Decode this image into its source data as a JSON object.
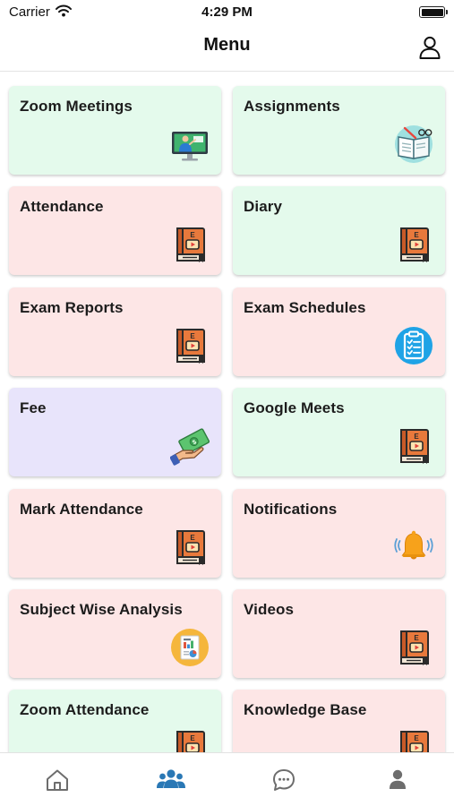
{
  "status_bar": {
    "carrier": "Carrier",
    "time": "4:29 PM"
  },
  "nav": {
    "title": "Menu",
    "profile_icon": "person-outline-icon"
  },
  "menu_items": [
    {
      "label": "Zoom Meetings",
      "icon": "teacher-screen-icon",
      "color": "#e4faec"
    },
    {
      "label": "Assignments",
      "icon": "open-book-icon",
      "color": "#e4faec"
    },
    {
      "label": "Attendance",
      "icon": "video-book-icon",
      "color": "#fde6e6"
    },
    {
      "label": "Diary",
      "icon": "video-book-icon",
      "color": "#e4faec"
    },
    {
      "label": "Exam Reports",
      "icon": "video-book-icon",
      "color": "#fde6e6"
    },
    {
      "label": "Exam Schedules",
      "icon": "checklist-icon",
      "color": "#fde6e6"
    },
    {
      "label": "Fee",
      "icon": "money-hand-icon",
      "color": "#e8e4fb"
    },
    {
      "label": "Google Meets",
      "icon": "video-book-icon",
      "color": "#e4faec"
    },
    {
      "label": "Mark Attendance",
      "icon": "video-book-icon",
      "color": "#fde6e6"
    },
    {
      "label": "Notifications",
      "icon": "bell-icon",
      "color": "#fde6e6"
    },
    {
      "label": "Subject Wise Analysis",
      "icon": "report-chart-icon",
      "color": "#fde6e6"
    },
    {
      "label": "Videos",
      "icon": "video-book-icon",
      "color": "#fde6e6"
    },
    {
      "label": "Zoom Attendance",
      "icon": "video-book-icon",
      "color": "#e4faec"
    },
    {
      "label": "Knowledge Base",
      "icon": "video-book-icon",
      "color": "#fde6e6"
    }
  ],
  "tab_bar": [
    {
      "icon": "home-icon",
      "active": false
    },
    {
      "icon": "users-icon",
      "active": true
    },
    {
      "icon": "chat-icon",
      "active": false
    },
    {
      "icon": "profile-icon",
      "active": false
    }
  ],
  "colors": {
    "tab_active": "#2a78b5",
    "tab_inactive": "#6d6d6d"
  }
}
